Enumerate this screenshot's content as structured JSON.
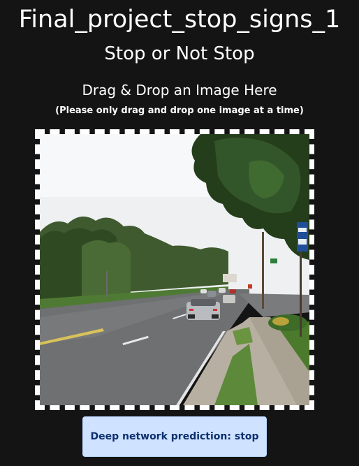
{
  "page": {
    "app_title": "Final_project_stop_signs_1",
    "subtitle": "Stop or Not Stop",
    "drop_heading": "Drag & Drop an Image Here",
    "drop_note": "(Please only drag and drop one image at a time)"
  },
  "image": {
    "alt": "street-scene-photo"
  },
  "result": {
    "label": "Deep network prediction: stop"
  }
}
